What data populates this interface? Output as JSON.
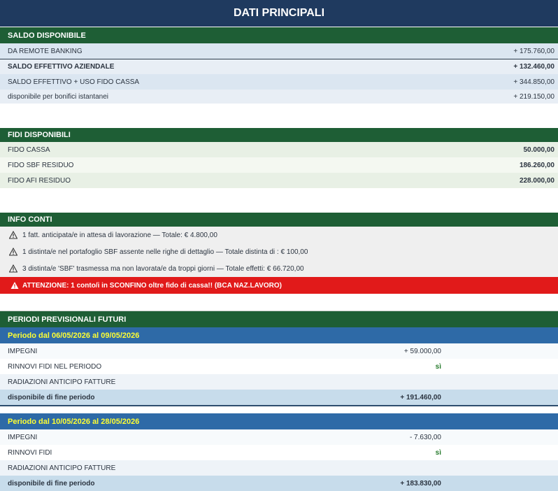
{
  "title": "DATI PRINCIPALI",
  "saldo": {
    "header": "SALDO DISPONIBILE",
    "rows": [
      {
        "label": "DA REMOTE BANKING",
        "value": "+ 175.760,00"
      },
      {
        "label": "SALDO EFFETTIVO AZIENDALE",
        "value": "+ 132.460,00"
      },
      {
        "label": "SALDO EFFETTIVO + USO FIDO CASSA",
        "value": "+ 344.850,00"
      },
      {
        "label": "disponibile per bonifici istantanei",
        "value": "+ 219.150,00"
      }
    ]
  },
  "fidi": {
    "header": "FIDI DISPONIBILI",
    "rows": [
      {
        "label": "FIDO CASSA",
        "value": "50.000,00"
      },
      {
        "label": "FIDO SBF RESIDUO",
        "value": "186.260,00"
      },
      {
        "label": "FIDO AFI RESIDUO",
        "value": "228.000,00"
      }
    ]
  },
  "info": {
    "header": "INFO CONTI",
    "items": [
      "1 fatt. anticipata/e in attesa di lavorazione — Totale: € 4.800,00",
      "1 distinta/e nel portafoglio SBF assente nelle righe di dettaglio — Totale distinta di : € 100,00",
      "3 distinta/e 'SBF' trasmessa ma non lavorata/e da troppi giorni — Totale effetti: € 66.720,00"
    ],
    "alert": "ATTENZIONE: 1 conto/i in SCONFINO oltre fido di cassa!! (BCA NAZ.LAVORO)"
  },
  "periodi": {
    "header": "PERIODI PREVISIONALI FUTURI",
    "blocks": [
      {
        "title": "Periodo dal 06/05/2026 al 09/05/2026",
        "rows": [
          {
            "label": "IMPEGNI",
            "value": "+ 59.000,00"
          },
          {
            "label": "RINNOVI FIDI NEL PERIODO",
            "value": "sì"
          },
          {
            "label": "RADIAZIONI ANTICIPO FATTURE",
            "value": ""
          },
          {
            "label": "disponibile di fine periodo",
            "value": "+ 191.460,00"
          }
        ]
      },
      {
        "title": "Periodo dal 10/05/2026 al 28/05/2026",
        "rows": [
          {
            "label": "IMPEGNI",
            "value": "- 7.630,00"
          },
          {
            "label": "RINNOVI FIDI",
            "value": "sì"
          },
          {
            "label": "RADIAZIONI ANTICIPO FATTURE",
            "value": ""
          },
          {
            "label": "disponibile di fine periodo",
            "value": "+ 183.830,00"
          }
        ]
      }
    ]
  },
  "colors": {
    "title_bg": "#1f3a5f",
    "section_bg": "#1e5e35",
    "alert_bg": "#e11a1a",
    "period_bg": "#2e6aa7",
    "period_title": "#ffff33"
  }
}
